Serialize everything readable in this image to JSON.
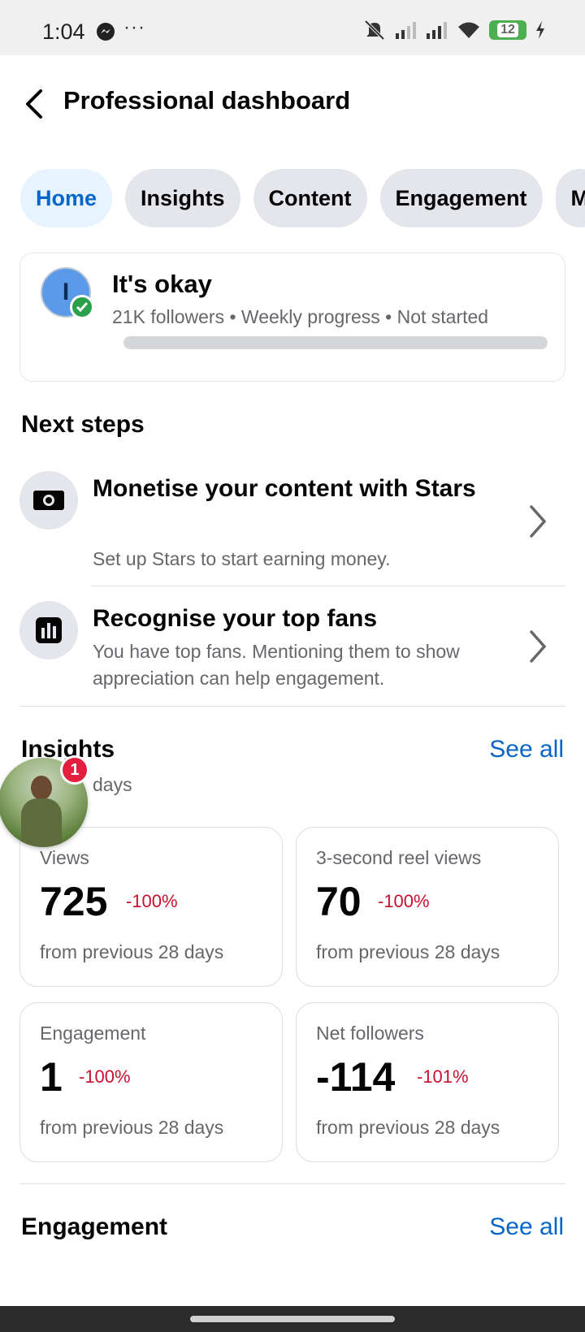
{
  "status_bar": {
    "time": "1:04",
    "dots": "···",
    "battery": "12"
  },
  "header": {
    "title": "Professional dashboard"
  },
  "tabs": [
    {
      "label": "Home",
      "active": true
    },
    {
      "label": "Insights",
      "active": false
    },
    {
      "label": "Content",
      "active": false
    },
    {
      "label": "Engagement",
      "active": false
    },
    {
      "label": "M",
      "active": false
    }
  ],
  "profile": {
    "avatar_letter": "I",
    "name": "It's okay",
    "meta": "21K followers • Weekly progress • Not started",
    "progress_percent": 0
  },
  "next_steps": {
    "title": "Next steps",
    "items": [
      {
        "title": "Monetise your content with Stars",
        "subtitle": "Set up Stars to start earning money.",
        "icon": "stars-money-icon"
      },
      {
        "title": "Recognise your top fans",
        "subtitle": "You have top fans. Mentioning them to show appreciation can help engagement.",
        "icon": "bar-chart-icon"
      }
    ]
  },
  "insights": {
    "title": "Insights",
    "see_all": "See all",
    "subtitle": "days",
    "cards": [
      {
        "label": "Views",
        "value": "725",
        "delta": "-100%",
        "from": "from previous 28 days"
      },
      {
        "label": "3-second reel views",
        "value": "70",
        "delta": "-100%",
        "from": "from previous 28 days"
      },
      {
        "label": "Engagement",
        "value": "1",
        "delta": "-100%",
        "from": "from previous 28 days"
      },
      {
        "label": "Net followers",
        "value": "-114",
        "delta": "-101%",
        "from": "from previous 28 days"
      }
    ]
  },
  "chat_head": {
    "badge": "1"
  },
  "engagement": {
    "title": "Engagement",
    "see_all": "See all"
  },
  "colors": {
    "accent": "#0866c8",
    "negative": "#c8102e",
    "chip": "#e4e6eb",
    "chip_active": "#e7f3ff"
  }
}
